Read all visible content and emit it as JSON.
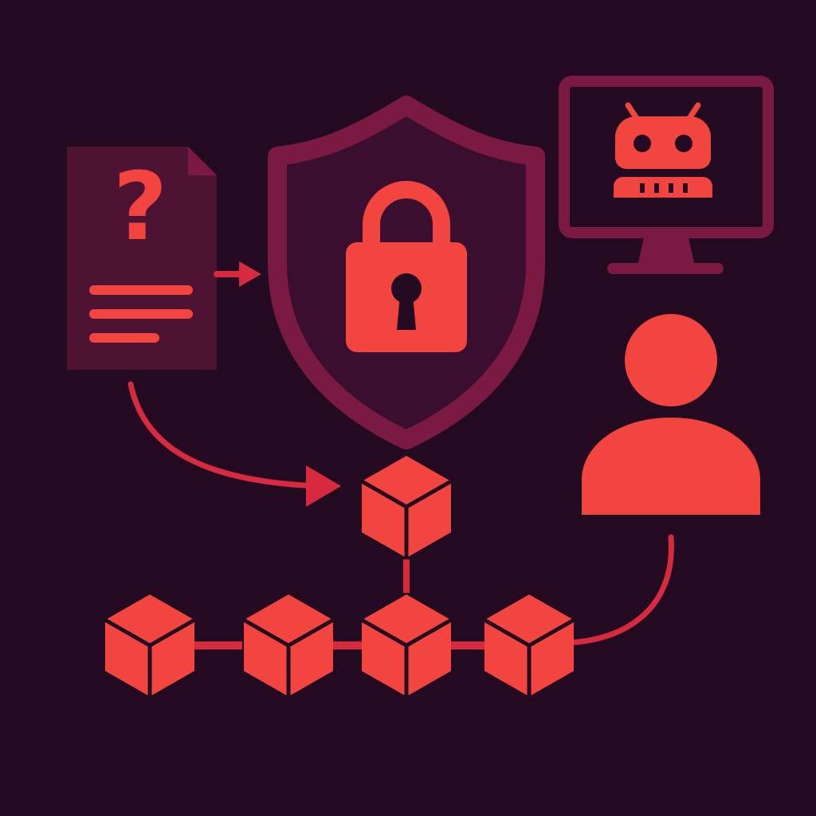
{
  "colors": {
    "background": "#240a21",
    "accent": "#f2453f",
    "accent_dark": "#d82a3f",
    "panel": "#4e1233",
    "panel_stroke": "#7a1a43",
    "shield_fill": "#3a0e2e",
    "keyhole": "#240a21"
  },
  "icons": [
    "question-document-icon",
    "shield-icon",
    "padlock-icon",
    "monitor-icon",
    "robot-icon",
    "person-icon",
    "blockchain-cube-icon"
  ],
  "document": {
    "symbol": "?"
  },
  "blockchain": {
    "top_block_count": 1,
    "chain_block_count": 4
  }
}
